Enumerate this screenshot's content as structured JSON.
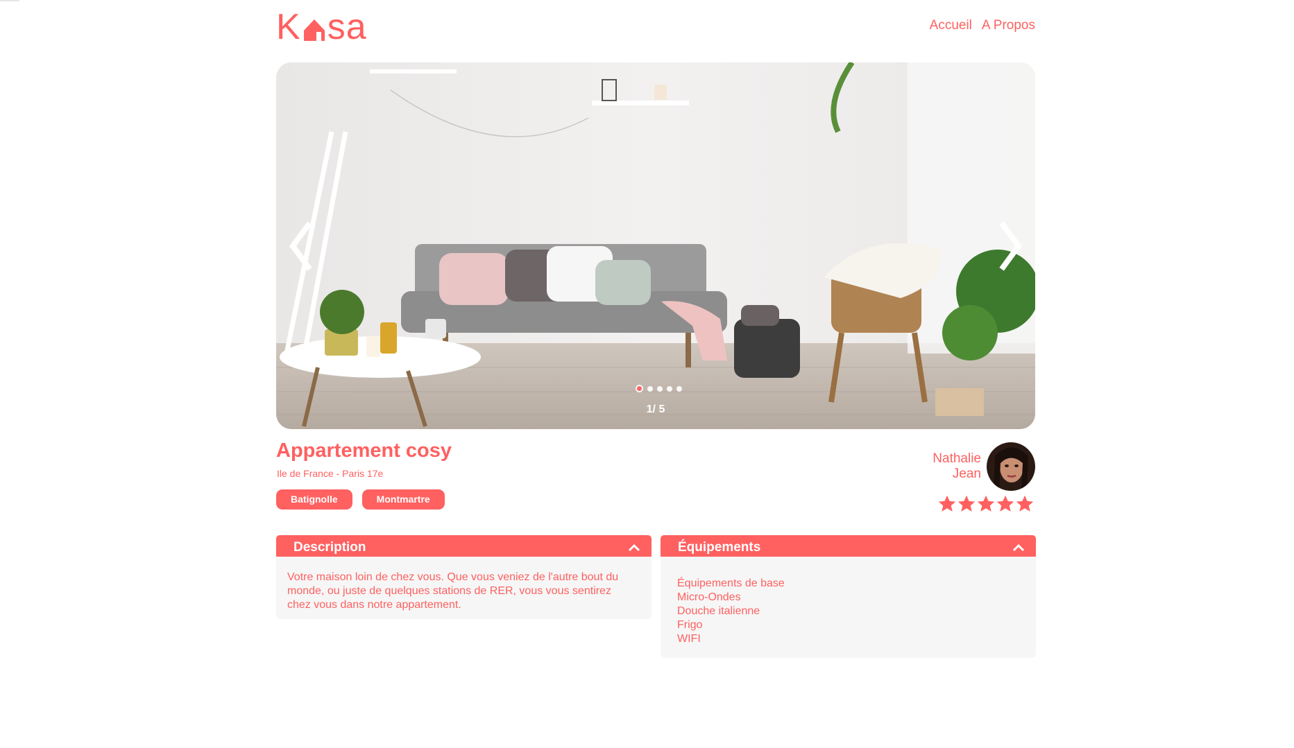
{
  "logo": {
    "text_before": "K",
    "text_after": "sa",
    "icon": "house-icon"
  },
  "nav": {
    "home": "Accueil",
    "about": "A Propos"
  },
  "carousel": {
    "counter": "1/ 5",
    "current_index": 1,
    "total": 5,
    "prev_icon": "chevron-left-icon",
    "next_icon": "chevron-right-icon"
  },
  "listing": {
    "title": "Appartement cosy",
    "location": "Ile de France - Paris 17e",
    "tags": [
      "Batignolle",
      "Montmartre"
    ]
  },
  "host": {
    "first_name": "Nathalie",
    "last_name": "Jean",
    "rating": 5,
    "rating_max": 5
  },
  "description": {
    "title": "Description",
    "text": "Votre maison loin de chez vous. Que vous veniez de l'autre bout du monde, ou juste de quelques stations de RER, vous vous sentirez chez vous dans notre appartement."
  },
  "equipments": {
    "title": "Équipements",
    "items": [
      "Équipements de base",
      "Micro-Ondes",
      "Douche italienne",
      "Frigo",
      "WIFI"
    ]
  },
  "colors": {
    "accent": "#FF6060",
    "panel_bg": "#F6F6F6"
  }
}
